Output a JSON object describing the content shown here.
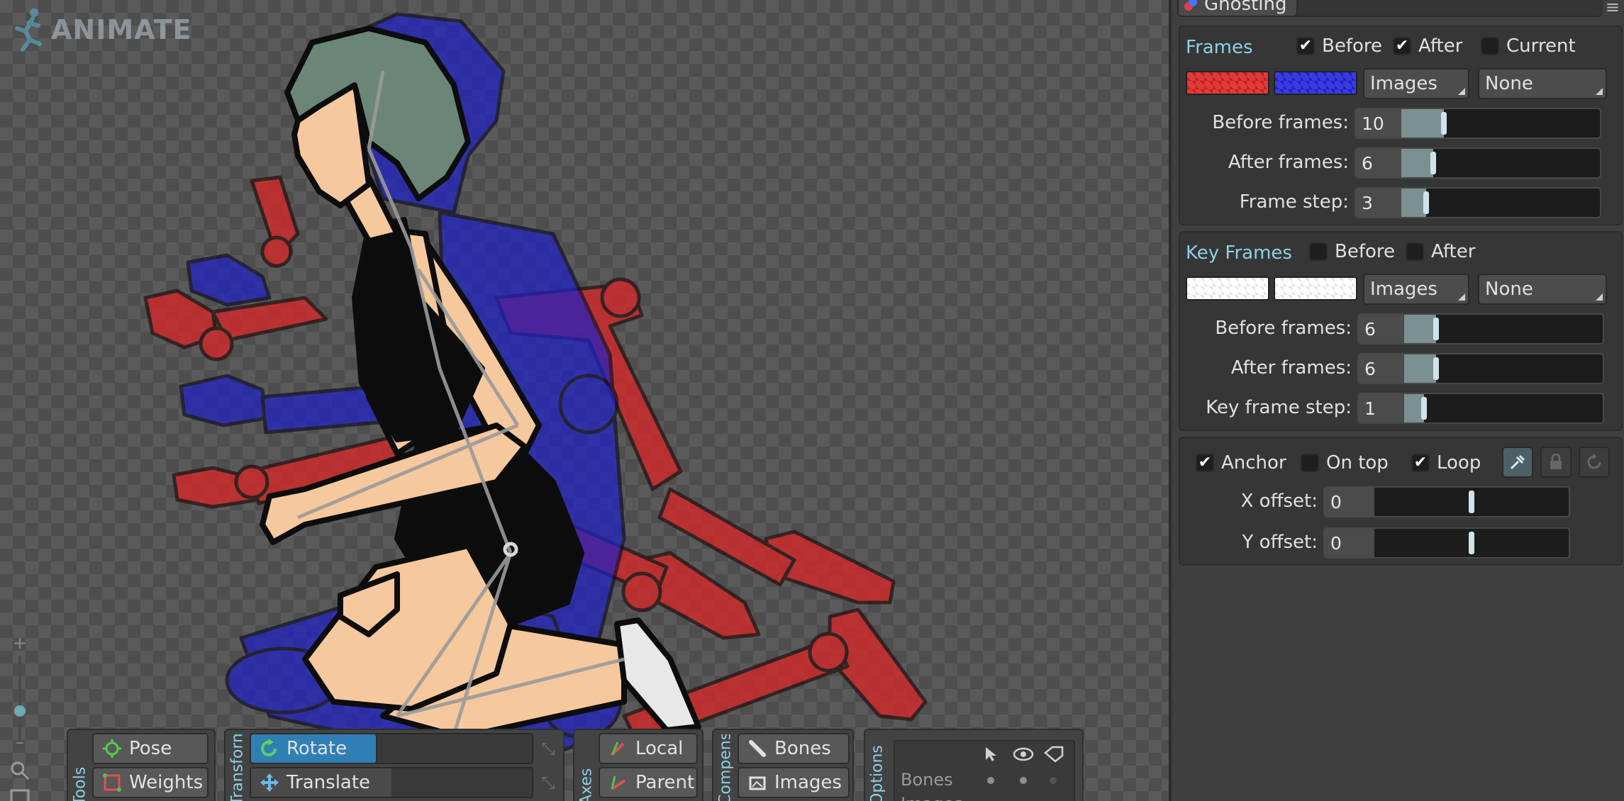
{
  "canvas": {
    "logo_text": "ANIMATE",
    "zoom": {
      "plus": "+",
      "minus": "–",
      "search_icon": "search-icon",
      "fit_icon": "fit-screen-icon"
    }
  },
  "toolbar": {
    "tools": {
      "label": "Tools",
      "pose": "Pose",
      "weights": "Weights"
    },
    "transform": {
      "label": "Transform",
      "rotate": "Rotate",
      "translate": "Translate",
      "active": "Rotate"
    },
    "axes": {
      "label": "Axes",
      "local": "Local",
      "parent": "Parent"
    },
    "compensate": {
      "label": "Compensate",
      "bones": "Bones",
      "images": "Images"
    },
    "options": {
      "label": "Options",
      "rows": [
        "Bones",
        "Images"
      ],
      "col_icons": [
        "cursor-icon",
        "eye-icon",
        "tag-icon"
      ]
    }
  },
  "panel": {
    "tab_title": "Ghosting",
    "frames": {
      "title": "Frames",
      "before": {
        "label": "Before",
        "checked": true
      },
      "after": {
        "label": "After",
        "checked": true
      },
      "current": {
        "label": "Current",
        "checked": false
      },
      "before_color": "#e23a3a",
      "after_color": "#3a3ae2",
      "mode": "Images",
      "blend": "None",
      "fields": [
        {
          "label": "Before frames:",
          "value": "10",
          "fraction": 0.43
        },
        {
          "label": "After frames:",
          "value": "6",
          "fraction": 0.32
        },
        {
          "label": "Frame step:",
          "value": "3",
          "fraction": 0.25
        }
      ]
    },
    "key_frames": {
      "title": "Key Frames",
      "before": {
        "label": "Before",
        "checked": false
      },
      "after": {
        "label": "After",
        "checked": false
      },
      "before_color": "#ffffff",
      "after_color": "#ffffff",
      "mode": "Images",
      "blend": "None",
      "fields": [
        {
          "label": "Before frames:",
          "value": "6",
          "fraction": 0.32
        },
        {
          "label": "After frames:",
          "value": "6",
          "fraction": 0.32
        },
        {
          "label": "Key frame step:",
          "value": "1",
          "fraction": 0.2
        }
      ]
    },
    "options": {
      "anchor": {
        "label": "Anchor",
        "checked": true
      },
      "on_top": {
        "label": "On top",
        "checked": false
      },
      "loop": {
        "label": "Loop",
        "checked": true
      },
      "icon_buttons": [
        "anchor-pick-icon",
        "lock-icon",
        "reset-icon"
      ],
      "fields": [
        {
          "label": "X offset:",
          "value": "0",
          "fraction": 0.5
        },
        {
          "label": "Y offset:",
          "value": "0",
          "fraction": 0.5
        }
      ]
    },
    "accent_color": "#8fd0e4"
  }
}
